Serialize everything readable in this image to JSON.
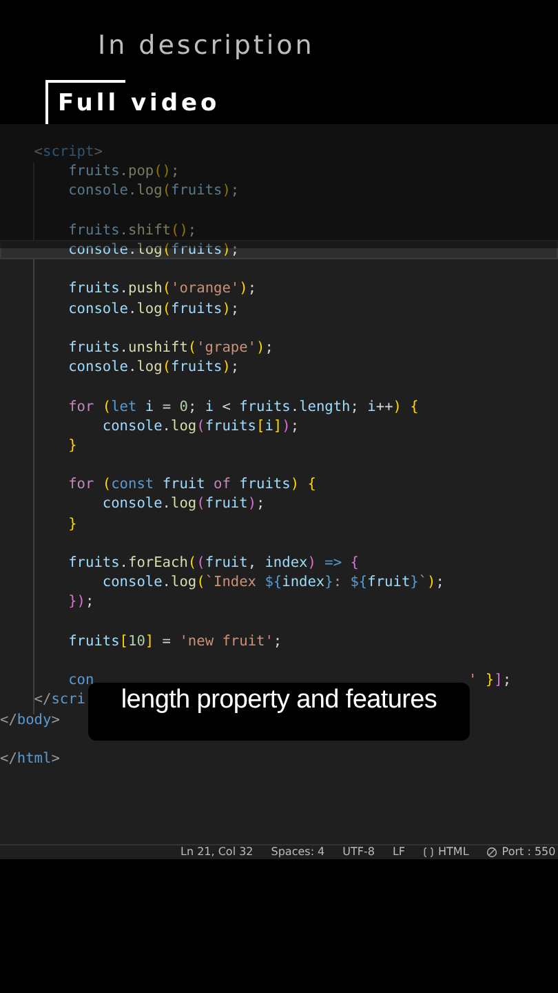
{
  "overlay_titles": {
    "subtitle": "In description",
    "title": "Full video"
  },
  "editor": {
    "lines": [
      {
        "current": false,
        "tokens": [
          {
            "kind": "tag",
            "t": "    <"
          },
          {
            "kind": "tagname",
            "t": "script"
          },
          {
            "kind": "tag",
            "t": ">"
          }
        ]
      },
      {
        "current": false,
        "tokens": [
          {
            "kind": "var",
            "t": "        fruits"
          },
          {
            "kind": "punct",
            "t": "."
          },
          {
            "kind": "method",
            "t": "pop"
          },
          {
            "kind": "paren",
            "t": "()"
          },
          {
            "kind": "punct",
            "t": ";"
          }
        ]
      },
      {
        "current": false,
        "tokens": [
          {
            "kind": "var",
            "t": "        console"
          },
          {
            "kind": "punct",
            "t": "."
          },
          {
            "kind": "method",
            "t": "log"
          },
          {
            "kind": "paren",
            "t": "("
          },
          {
            "kind": "var",
            "t": "fruits"
          },
          {
            "kind": "paren",
            "t": ")"
          },
          {
            "kind": "punct",
            "t": ";"
          }
        ]
      },
      {
        "current": false
      },
      {
        "current": false,
        "tokens": [
          {
            "kind": "var",
            "t": "        fruits"
          },
          {
            "kind": "punct",
            "t": "."
          },
          {
            "kind": "method",
            "t": "shift"
          },
          {
            "kind": "paren",
            "t": "()"
          },
          {
            "kind": "punct",
            "t": ";"
          }
        ]
      },
      {
        "current": true,
        "tokens": [
          {
            "kind": "var",
            "t": "        console"
          },
          {
            "kind": "punct",
            "t": "."
          },
          {
            "kind": "method",
            "t": "log"
          },
          {
            "kind": "paren",
            "t": "("
          },
          {
            "kind": "var",
            "t": "fruits"
          },
          {
            "kind": "paren",
            "t": ")"
          },
          {
            "kind": "punct",
            "t": ";"
          }
        ]
      },
      {
        "current": false
      },
      {
        "current": false,
        "tokens": [
          {
            "kind": "var",
            "t": "        fruits"
          },
          {
            "kind": "punct",
            "t": "."
          },
          {
            "kind": "method",
            "t": "push"
          },
          {
            "kind": "paren",
            "t": "("
          },
          {
            "kind": "string",
            "t": "'orange'"
          },
          {
            "kind": "paren",
            "t": ")"
          },
          {
            "kind": "punct",
            "t": ";"
          }
        ]
      },
      {
        "current": false,
        "tokens": [
          {
            "kind": "var",
            "t": "        console"
          },
          {
            "kind": "punct",
            "t": "."
          },
          {
            "kind": "method",
            "t": "log"
          },
          {
            "kind": "paren",
            "t": "("
          },
          {
            "kind": "var",
            "t": "fruits"
          },
          {
            "kind": "paren",
            "t": ")"
          },
          {
            "kind": "punct",
            "t": ";"
          }
        ]
      },
      {
        "current": false
      },
      {
        "current": false,
        "tokens": [
          {
            "kind": "var",
            "t": "        fruits"
          },
          {
            "kind": "punct",
            "t": "."
          },
          {
            "kind": "method",
            "t": "unshift"
          },
          {
            "kind": "paren",
            "t": "("
          },
          {
            "kind": "string",
            "t": "'grape'"
          },
          {
            "kind": "paren",
            "t": ")"
          },
          {
            "kind": "punct",
            "t": ";"
          }
        ]
      },
      {
        "current": false,
        "tokens": [
          {
            "kind": "var",
            "t": "        console"
          },
          {
            "kind": "punct",
            "t": "."
          },
          {
            "kind": "method",
            "t": "log"
          },
          {
            "kind": "paren",
            "t": "("
          },
          {
            "kind": "var",
            "t": "fruits"
          },
          {
            "kind": "paren",
            "t": ")"
          },
          {
            "kind": "punct",
            "t": ";"
          }
        ]
      },
      {
        "current": false
      },
      {
        "current": false,
        "tokens": [
          {
            "kind": "keyword",
            "t": "        for "
          },
          {
            "kind": "paren",
            "t": "("
          },
          {
            "kind": "storage",
            "t": "let "
          },
          {
            "kind": "var",
            "t": "i"
          },
          {
            "kind": "punct",
            "t": " = "
          },
          {
            "kind": "number",
            "t": "0"
          },
          {
            "kind": "punct",
            "t": "; "
          },
          {
            "kind": "var",
            "t": "i"
          },
          {
            "kind": "punct",
            "t": " < "
          },
          {
            "kind": "var",
            "t": "fruits"
          },
          {
            "kind": "punct",
            "t": "."
          },
          {
            "kind": "var",
            "t": "length"
          },
          {
            "kind": "punct",
            "t": "; "
          },
          {
            "kind": "var",
            "t": "i"
          },
          {
            "kind": "punct",
            "t": "++"
          },
          {
            "kind": "paren",
            "t": ") {"
          }
        ]
      },
      {
        "current": false,
        "tokens": [
          {
            "kind": "var",
            "t": "            console"
          },
          {
            "kind": "punct",
            "t": "."
          },
          {
            "kind": "method",
            "t": "log"
          },
          {
            "kind": "brace",
            "t": "("
          },
          {
            "kind": "var",
            "t": "fruits"
          },
          {
            "kind": "paren",
            "t": "["
          },
          {
            "kind": "var",
            "t": "i"
          },
          {
            "kind": "paren",
            "t": "]"
          },
          {
            "kind": "brace",
            "t": ")"
          },
          {
            "kind": "punct",
            "t": ";"
          }
        ]
      },
      {
        "current": false,
        "tokens": [
          {
            "kind": "paren",
            "t": "        }"
          }
        ]
      },
      {
        "current": false
      },
      {
        "current": false,
        "tokens": [
          {
            "kind": "keyword",
            "t": "        for "
          },
          {
            "kind": "paren",
            "t": "("
          },
          {
            "kind": "storage",
            "t": "const "
          },
          {
            "kind": "var",
            "t": "fruit "
          },
          {
            "kind": "keyword",
            "t": "of "
          },
          {
            "kind": "var",
            "t": "fruits"
          },
          {
            "kind": "paren",
            "t": ") {"
          }
        ]
      },
      {
        "current": false,
        "tokens": [
          {
            "kind": "var",
            "t": "            console"
          },
          {
            "kind": "punct",
            "t": "."
          },
          {
            "kind": "method",
            "t": "log"
          },
          {
            "kind": "brace",
            "t": "("
          },
          {
            "kind": "var",
            "t": "fruit"
          },
          {
            "kind": "brace",
            "t": ")"
          },
          {
            "kind": "punct",
            "t": ";"
          }
        ]
      },
      {
        "current": false,
        "tokens": [
          {
            "kind": "paren",
            "t": "        }"
          }
        ]
      },
      {
        "current": false
      },
      {
        "current": false,
        "tokens": [
          {
            "kind": "var",
            "t": "        fruits"
          },
          {
            "kind": "punct",
            "t": "."
          },
          {
            "kind": "method",
            "t": "forEach"
          },
          {
            "kind": "paren",
            "t": "("
          },
          {
            "kind": "brace",
            "t": "("
          },
          {
            "kind": "var",
            "t": "fruit"
          },
          {
            "kind": "punct",
            "t": ", "
          },
          {
            "kind": "var",
            "t": "index"
          },
          {
            "kind": "brace",
            "t": ")"
          },
          {
            "kind": "storage",
            "t": " => "
          },
          {
            "kind": "brace",
            "t": "{"
          }
        ]
      },
      {
        "current": false,
        "tokens": [
          {
            "kind": "var",
            "t": "            console"
          },
          {
            "kind": "punct",
            "t": "."
          },
          {
            "kind": "method",
            "t": "log"
          },
          {
            "kind": "paren",
            "t": "("
          },
          {
            "kind": "string",
            "t": "`Index "
          },
          {
            "kind": "storage",
            "t": "${"
          },
          {
            "kind": "var",
            "t": "index"
          },
          {
            "kind": "storage",
            "t": "}"
          },
          {
            "kind": "string",
            "t": ": "
          },
          {
            "kind": "storage",
            "t": "${"
          },
          {
            "kind": "var",
            "t": "fruit"
          },
          {
            "kind": "storage",
            "t": "}"
          },
          {
            "kind": "string",
            "t": "`"
          },
          {
            "kind": "paren",
            "t": ")"
          },
          {
            "kind": "punct",
            "t": ";"
          }
        ]
      },
      {
        "current": false,
        "tokens": [
          {
            "kind": "brace",
            "t": "        })"
          },
          {
            "kind": "punct",
            "t": ";"
          }
        ]
      },
      {
        "current": false
      },
      {
        "current": false,
        "tokens": [
          {
            "kind": "var",
            "t": "        fruits"
          },
          {
            "kind": "paren",
            "t": "["
          },
          {
            "kind": "number",
            "t": "10"
          },
          {
            "kind": "paren",
            "t": "]"
          },
          {
            "kind": "punct",
            "t": " = "
          },
          {
            "kind": "string",
            "t": "'new fruit'"
          },
          {
            "kind": "punct",
            "t": ";"
          }
        ]
      },
      {
        "current": false
      },
      {
        "current": false,
        "tokens": [
          {
            "kind": "storage",
            "t": "        con"
          }
        ],
        "tail": [
          {
            "kind": "string",
            "t": "'"
          },
          {
            "kind": "paren",
            "t": " }"
          },
          {
            "kind": "brace",
            "t": "]"
          },
          {
            "kind": "punct",
            "t": ";"
          }
        ]
      },
      {
        "current": false,
        "tokens": [
          {
            "kind": "tag",
            "t": "    </"
          },
          {
            "kind": "tagname",
            "t": "scri"
          }
        ]
      },
      {
        "current": false,
        "tokens": [
          {
            "kind": "tag",
            "t": "</"
          },
          {
            "kind": "tagname",
            "t": "body"
          },
          {
            "kind": "tag",
            "t": ">"
          }
        ]
      },
      {
        "current": false
      },
      {
        "current": false,
        "tokens": [
          {
            "kind": "tag",
            "t": "</"
          },
          {
            "kind": "tagname",
            "t": "html"
          },
          {
            "kind": "tag",
            "t": ">"
          }
        ]
      }
    ]
  },
  "caption": "length property and features",
  "status_bar": [
    {
      "kind": "text",
      "text": "Ln 21, Col 32"
    },
    {
      "kind": "text",
      "text": "Spaces: 4"
    },
    {
      "kind": "text",
      "text": "UTF-8"
    },
    {
      "kind": "text",
      "text": "LF"
    },
    {
      "kind": "language",
      "text": "HTML"
    },
    {
      "kind": "port",
      "text": "Port : 550"
    }
  ]
}
